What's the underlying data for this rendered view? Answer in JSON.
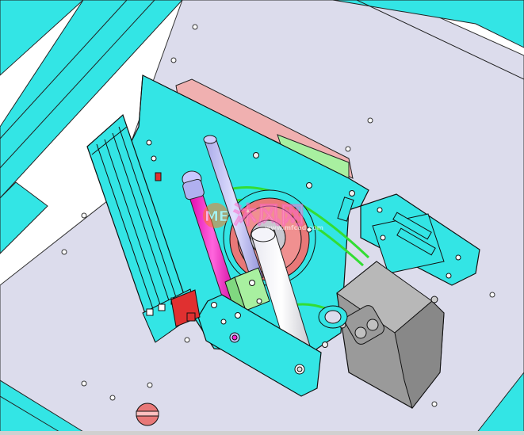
{
  "watermark": {
    "logo_text": "ME",
    "cn_text": "沐风网",
    "url_text": "www.mfcad.com"
  },
  "colors": {
    "background": "#ffffff",
    "plate": "#dcdcec",
    "frame_cyan": "#33e5e5",
    "edge": "#101010",
    "motor_grey": "#9a9a9a",
    "pulley_red": "#e87878",
    "belt_green": "#33dd33",
    "rod_magenta": "#ff22cc",
    "rod_lavender": "#c8c8ff",
    "pink_part": "#f0b0b0",
    "light_green": "#a8f0a0",
    "red_part": "#e03030"
  }
}
